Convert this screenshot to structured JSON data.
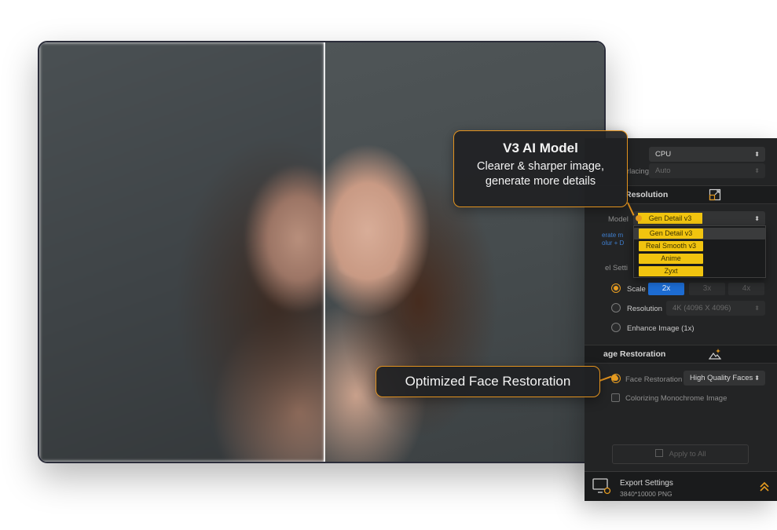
{
  "callouts": {
    "v3_title": "V3 AI Model",
    "v3_line1": "Clearer & sharper image,",
    "v3_line2": "generate more details",
    "face_title": "Optimized Face Restoration"
  },
  "panel": {
    "device_value": "CPU",
    "interlacing_label": "rlacing",
    "interlacing_value": "Auto",
    "resolution_section": "Resolution",
    "model_label": "Model",
    "model_value": "Gen Detail v3",
    "model_desc_1": "erate m",
    "model_desc_2": "olur + D",
    "model_options": [
      "Gen Detail v3",
      "Real Smooth v3",
      "Anime",
      "Zyxt"
    ],
    "model_settings_label": "el Setti",
    "scale_label": "Scale",
    "scale_options": [
      "2x",
      "3x",
      "4x"
    ],
    "resolution_label": "Resolution",
    "resolution_value": "4K (4096 X 4096)",
    "enhance_label": "Enhance Image (1x)",
    "restoration_section": "age Restoration",
    "face_restoration_label": "Face Restoration",
    "face_restoration_value": "High Quality Faces",
    "colorize_label": "Colorizing Monochrome Image",
    "apply_label": "Apply to All",
    "export_title": "Export Settings",
    "export_detail": "3840*10000  PNG"
  },
  "colors": {
    "accent_orange": "#e2921e",
    "highlight_yellow": "#f1c40f",
    "scale_active_blue": "#1d6cd2"
  }
}
